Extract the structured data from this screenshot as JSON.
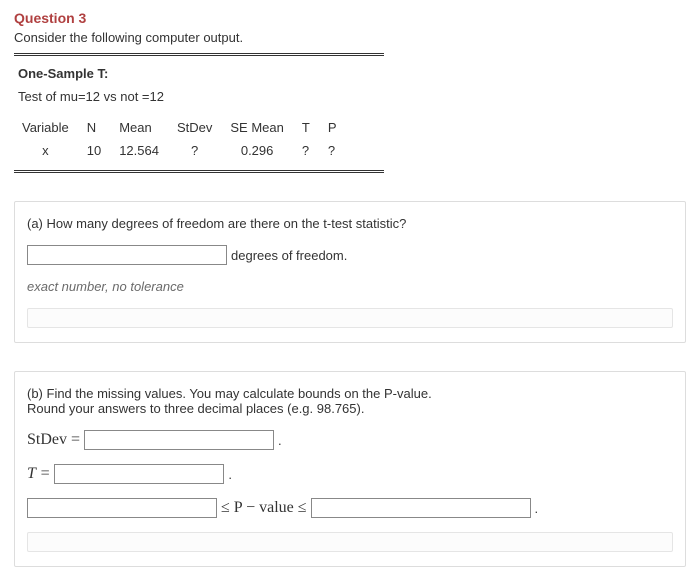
{
  "question": {
    "title": "Question 3",
    "prompt": "Consider the following computer output."
  },
  "output": {
    "heading": "One-Sample T:",
    "test_of": "Test of mu=12 vs not =12",
    "columns": [
      "Variable",
      "N",
      "Mean",
      "StDev",
      "SE Mean",
      "T",
      "P"
    ],
    "row": {
      "Variable": "x",
      "N": "10",
      "Mean": "12.564",
      "StDev": "?",
      "SE_Mean": "0.296",
      "T": "?",
      "P": "?"
    }
  },
  "part_a": {
    "text": "(a) How many degrees of freedom are there on the t-test statistic?",
    "trail": "degrees of freedom.",
    "hint": "exact number, no tolerance"
  },
  "part_b": {
    "line1": "(b) Find the missing values. You may calculate bounds on the P-value.",
    "line2": "Round your answers to three decimal places (e.g. 98.765).",
    "stdev_label": "StDev =",
    "t_label": "T =",
    "pv_mid": "≤ P − value ≤",
    "dot": "."
  },
  "chart_data": {
    "type": "table",
    "title": "One-Sample T",
    "columns": [
      "Variable",
      "N",
      "Mean",
      "StDev",
      "SE Mean",
      "T",
      "P"
    ],
    "rows": [
      {
        "Variable": "x",
        "N": 10,
        "Mean": 12.564,
        "StDev": null,
        "SE Mean": 0.296,
        "T": null,
        "P": null
      }
    ],
    "hypothesis": {
      "mu0": 12,
      "alternative": "two-sided"
    }
  }
}
